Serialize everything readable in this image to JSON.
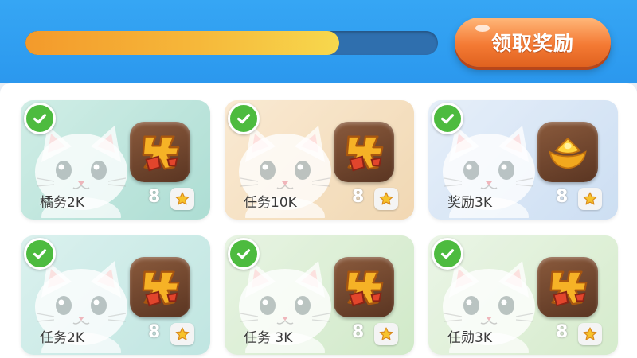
{
  "progress": {
    "fill_fraction": 0.76
  },
  "claim_button": {
    "label": "领取奖励"
  },
  "cards": [
    {
      "label": "橘务2K",
      "count": "8",
      "reward_icon": "reward-character-icon",
      "completed": true,
      "bg_from": "#bfe7dd",
      "bg_to": "#8ed1c3"
    },
    {
      "label": "任务10K",
      "count": "8",
      "reward_icon": "reward-character-icon",
      "completed": true,
      "bg_from": "#f8e2c2",
      "bg_to": "#ecc996"
    },
    {
      "label": "奖励3K",
      "count": "8",
      "reward_icon": "gold-ingot-icon",
      "completed": true,
      "bg_from": "#dde9f7",
      "bg_to": "#b9d2ee"
    },
    {
      "label": "任务2K",
      "count": "8",
      "reward_icon": "reward-character-icon",
      "completed": true,
      "bg_from": "#cdece8",
      "bg_to": "#a8dcd6"
    },
    {
      "label": "任务 3K",
      "count": "8",
      "reward_icon": "reward-character-icon",
      "completed": true,
      "bg_from": "#dff0d8",
      "bg_to": "#bfe1b4"
    },
    {
      "label": "任勋3K",
      "count": "8",
      "reward_icon": "reward-character-icon",
      "completed": true,
      "bg_from": "#e3f2dd",
      "bg_to": "#c6e4b9"
    }
  ],
  "colors": {
    "header_blue": "#2b98ee",
    "progress_fill": "#f6b83a",
    "button_orange": "#f47a34",
    "check_green": "#4dbb3f"
  }
}
